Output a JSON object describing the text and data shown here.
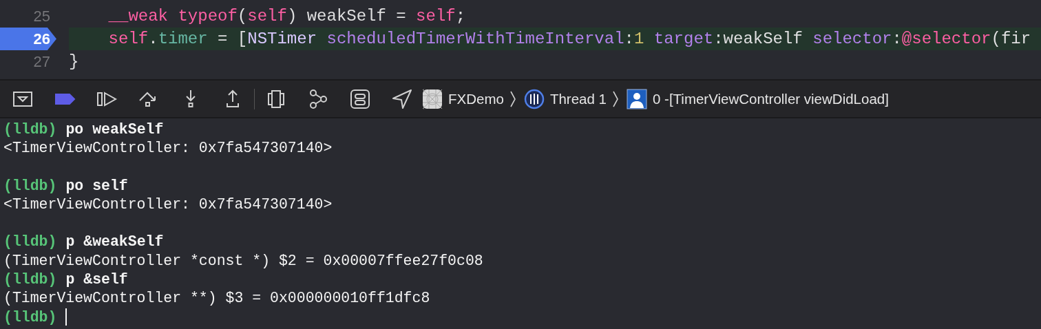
{
  "editor": {
    "lines": [
      {
        "number": "25",
        "current": false,
        "tokens": [
          {
            "kind": "keyword",
            "text": "    __weak"
          },
          {
            "kind": "keyword",
            "text": " typeof"
          },
          {
            "kind": "plain",
            "text": "("
          },
          {
            "kind": "keyword",
            "text": "self"
          },
          {
            "kind": "plain",
            "text": ") weakSelf = "
          },
          {
            "kind": "keyword",
            "text": "self"
          },
          {
            "kind": "plain",
            "text": ";"
          }
        ]
      },
      {
        "number": "26",
        "current": true,
        "tokens": [
          {
            "kind": "keyword",
            "text": "    self"
          },
          {
            "kind": "plain",
            "text": "."
          },
          {
            "kind": "property",
            "text": "timer"
          },
          {
            "kind": "plain",
            "text": " = ["
          },
          {
            "kind": "class",
            "text": "NSTimer"
          },
          {
            "kind": "method",
            "text": " scheduledTimerWithTimeInterval"
          },
          {
            "kind": "plain",
            "text": ":"
          },
          {
            "kind": "number",
            "text": "1"
          },
          {
            "kind": "method",
            "text": " target"
          },
          {
            "kind": "plain",
            "text": ":weakSelf "
          },
          {
            "kind": "method",
            "text": "selector"
          },
          {
            "kind": "plain",
            "text": ":"
          },
          {
            "kind": "keyword",
            "text": "@selector"
          },
          {
            "kind": "plain",
            "text": "(fir"
          }
        ]
      },
      {
        "number": "27",
        "current": false,
        "tokens": [
          {
            "kind": "plain",
            "text": "}"
          }
        ]
      }
    ]
  },
  "debug_bar": {
    "breakpoints_active": true,
    "breadcrumb": [
      {
        "kind": "app",
        "label": "FXDemo"
      },
      {
        "kind": "thread",
        "label": "Thread 1"
      },
      {
        "kind": "frame",
        "label": "0 -[TimerViewController viewDidLoad]"
      }
    ]
  },
  "console": {
    "lines": [
      {
        "kind": "prompt",
        "prompt": "(lldb)",
        "command": "po weakSelf"
      },
      {
        "kind": "output",
        "text": "<TimerViewController: 0x7fa547307140>"
      },
      {
        "kind": "blank"
      },
      {
        "kind": "prompt",
        "prompt": "(lldb)",
        "command": "po self"
      },
      {
        "kind": "output",
        "text": "<TimerViewController: 0x7fa547307140>"
      },
      {
        "kind": "blank"
      },
      {
        "kind": "prompt",
        "prompt": "(lldb)",
        "command": "p &weakSelf"
      },
      {
        "kind": "output",
        "text": "(TimerViewController *const *) $2 = 0x00007ffee27f0c08"
      },
      {
        "kind": "prompt",
        "prompt": "(lldb)",
        "command": "p &self"
      },
      {
        "kind": "output",
        "text": "(TimerViewController **) $3 = 0x000000010ff1dfc8"
      },
      {
        "kind": "prompt",
        "prompt": "(lldb)",
        "cursor": true
      }
    ]
  }
}
